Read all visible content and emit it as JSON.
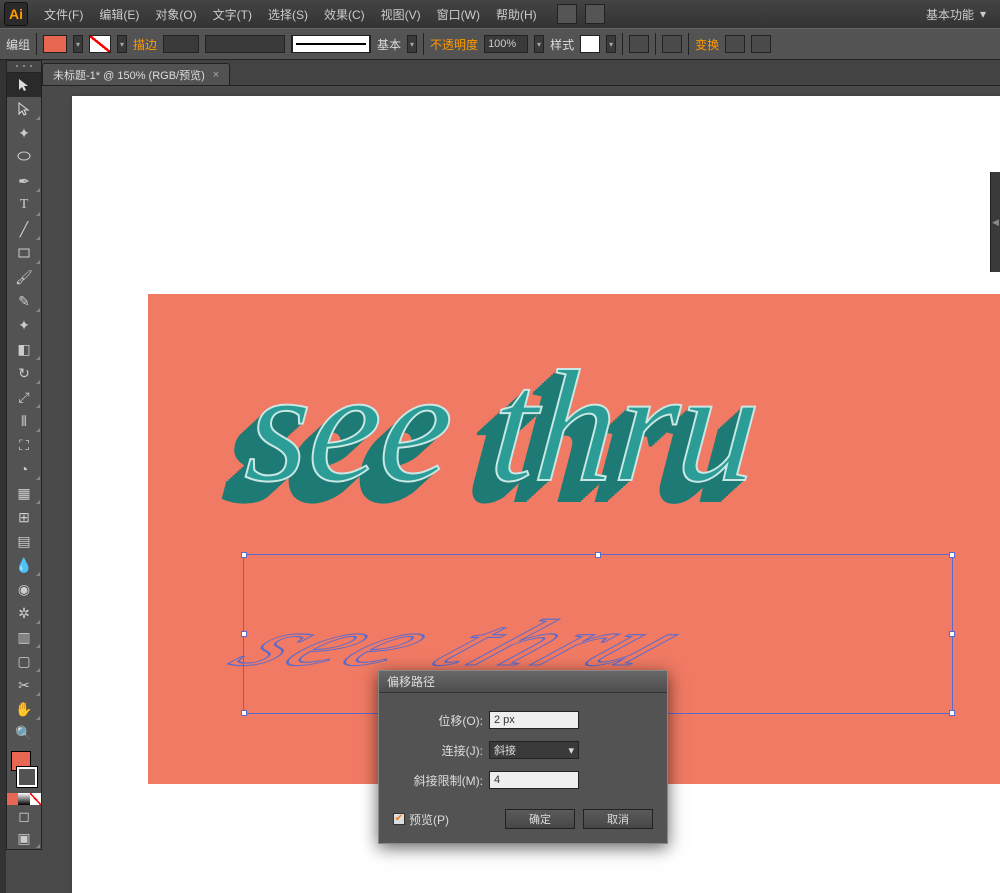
{
  "app": {
    "logo_text": "Ai"
  },
  "menus": [
    "文件(F)",
    "编辑(E)",
    "对象(O)",
    "文字(T)",
    "选择(S)",
    "效果(C)",
    "视图(V)",
    "窗口(W)",
    "帮助(H)"
  ],
  "workspace": {
    "label": "基本功能",
    "chevron": "▾"
  },
  "controlbar": {
    "selection_label": "编组",
    "stroke_label": "描边",
    "stroke_weight_placeholder": "",
    "brush_label": "基本",
    "opacity_label": "不透明度",
    "opacity_value": "100%",
    "style_label": "样式",
    "transform_label": "变换"
  },
  "doc_tab": {
    "title": "未标题-1* @ 150% (RGB/预览)",
    "close": "×"
  },
  "artwork": {
    "main_text": "see thru",
    "shadow_text": "see thru"
  },
  "dialog": {
    "title": "偏移路径",
    "offset_label": "位移(O):",
    "offset_value": "2 px",
    "join_label": "连接(J):",
    "join_value": "斜接",
    "miter_label": "斜接限制(M):",
    "miter_value": "4",
    "preview_label": "预览(P)",
    "ok": "确定",
    "cancel": "取消"
  },
  "tools": [
    "selection",
    "direct-selection",
    "magic-wand",
    "lasso",
    "pen",
    "type",
    "line",
    "rectangle",
    "paintbrush",
    "pencil",
    "blob-brush",
    "eraser",
    "rotate",
    "scale",
    "width",
    "free-transform",
    "shape-builder",
    "perspective-grid",
    "mesh",
    "gradient",
    "eyedropper",
    "blend",
    "symbol-sprayer",
    "column-graph",
    "artboard",
    "slice",
    "hand",
    "zoom"
  ]
}
